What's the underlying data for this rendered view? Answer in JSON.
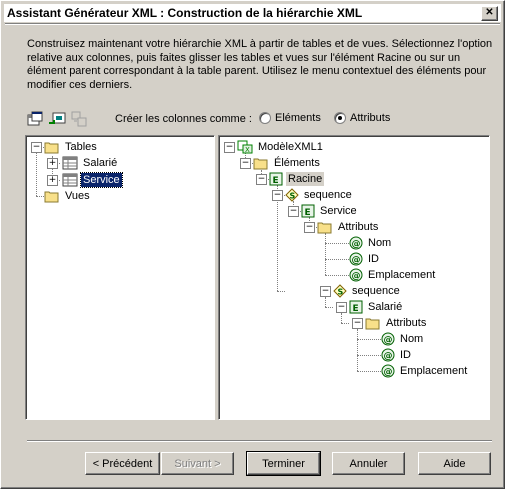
{
  "window": {
    "title": "Assistant Générateur XML : Construction de la hiérarchie XML",
    "close_label": "✕"
  },
  "instructions": "Construisez maintenant votre hiérarchie XML à partir de tables et de vues. Sélectionnez l'option relative aux colonnes, puis faites glisser les tables et vues sur l'élément Racine ou sur un élément parent correspondant à la table parent. Utilisez le menu contextuel des éléments pour modifier ces derniers.",
  "columns": {
    "label": "Créer les colonnes comme :",
    "options": [
      "Eléments",
      "Attributs"
    ],
    "selected": "Attributs"
  },
  "left_tree": {
    "tables": "Tables",
    "salarie": "Salarié",
    "service": "Service",
    "vues": "Vues"
  },
  "right_tree": {
    "model": "ModèleXML1",
    "elements": "Éléments",
    "racine": "Racine",
    "sequence1": "sequence",
    "service": "Service",
    "attributs1": "Attributs",
    "nom1": "Nom",
    "id1": "ID",
    "emplacement1": "Emplacement",
    "sequence2": "sequence",
    "salarie": "Salarié",
    "attributs2": "Attributs",
    "nom2": "Nom",
    "id2": "ID",
    "emplacement2": "Emplacement"
  },
  "buttons": {
    "prev": "< Précédent",
    "next": "Suivant >",
    "finish": "Terminer",
    "cancel": "Annuler",
    "help": "Aide"
  }
}
